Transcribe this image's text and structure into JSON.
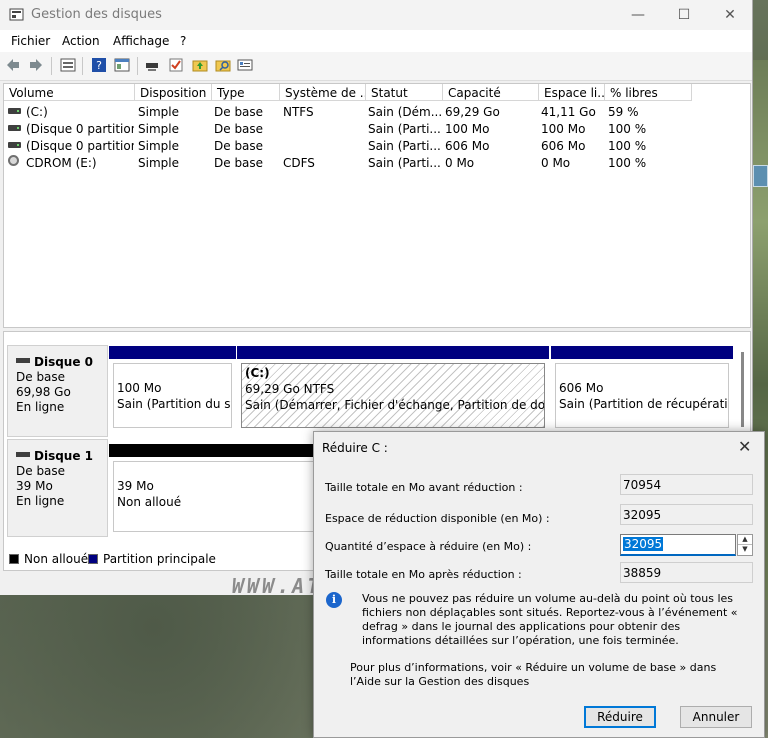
{
  "window": {
    "title": "Gestion des disques"
  },
  "menu": [
    "Fichier",
    "Action",
    "Affichage",
    "?"
  ],
  "toolbar_icons": [
    "back-arrow-icon",
    "forward-arrow-icon",
    "disk-list-icon",
    "help-icon",
    "console-icon",
    "connect-icon",
    "check-icon",
    "folder-up-icon",
    "search-folder-icon",
    "properties-icon"
  ],
  "volume_table": {
    "headers": [
      "Volume",
      "Disposition",
      "Type",
      "Système de ...",
      "Statut",
      "Capacité",
      "Espace li...",
      "% libres"
    ],
    "rows": [
      [
        "(C:)",
        "Simple",
        "De base",
        "NTFS",
        "Sain (Dém...",
        "69,29 Go",
        "41,11 Go",
        "59 %"
      ],
      [
        "(Disque 0 partition...",
        "Simple",
        "De base",
        "",
        "Sain (Parti...",
        "100 Mo",
        "100 Mo",
        "100 %"
      ],
      [
        "(Disque 0 partition...",
        "Simple",
        "De base",
        "",
        "Sain (Parti...",
        "606 Mo",
        "606 Mo",
        "100 %"
      ],
      [
        "CDROM (E:)",
        "Simple",
        "De base",
        "CDFS",
        "Sain (Parti...",
        "0 Mo",
        "0 Mo",
        "100 %"
      ]
    ]
  },
  "disks": [
    {
      "name": "Disque 0",
      "type": "De base",
      "size": "69,98 Go",
      "state": "En ligne",
      "partitions": [
        {
          "title": "",
          "line1": "100 Mo",
          "line2": "Sain (Partition du syst"
        },
        {
          "title": "(C:)",
          "line1": "69,29 Go NTFS",
          "line2": "Sain (Démarrer, Fichier d'échange, Partition de données de"
        },
        {
          "title": "",
          "line1": "606 Mo",
          "line2": "Sain (Partition de récupération)"
        }
      ]
    },
    {
      "name": "Disque 1",
      "type": "De base",
      "size": "39 Mo",
      "state": "En ligne",
      "partitions": [
        {
          "title": "",
          "line1": "39 Mo",
          "line2": "Non alloué"
        }
      ]
    }
  ],
  "legend": [
    "Non alloué",
    "Partition principale"
  ],
  "colors": {
    "unallocated": "#000000",
    "primary": "#000080",
    "accent": "#0078d7"
  },
  "watermark": "WWW.ATELIER-ASUS.FR",
  "dialog": {
    "title": "Réduire C :",
    "fields": [
      {
        "label": "Taille totale en Mo avant réduction :",
        "value": "70954"
      },
      {
        "label": "Espace de réduction disponible (en Mo) :",
        "value": "32095"
      },
      {
        "label": "Quantité d’espace à réduire (en Mo) :",
        "value": "32095"
      },
      {
        "label": "Taille totale en Mo après réduction :",
        "value": "38859"
      }
    ],
    "info": "Vous ne pouvez pas réduire un volume au-delà du point où tous les fichiers non déplaçables sont situés. Reportez-vous à l’événement « defrag » dans le journal des applications pour obtenir des informations détaillées sur l’opération, une fois terminée.",
    "help": "Pour plus d’informations, voir « Réduire un volume de base » dans l’Aide sur la Gestion des disques",
    "ok_label": "Réduire",
    "cancel_label": "Annuler"
  }
}
